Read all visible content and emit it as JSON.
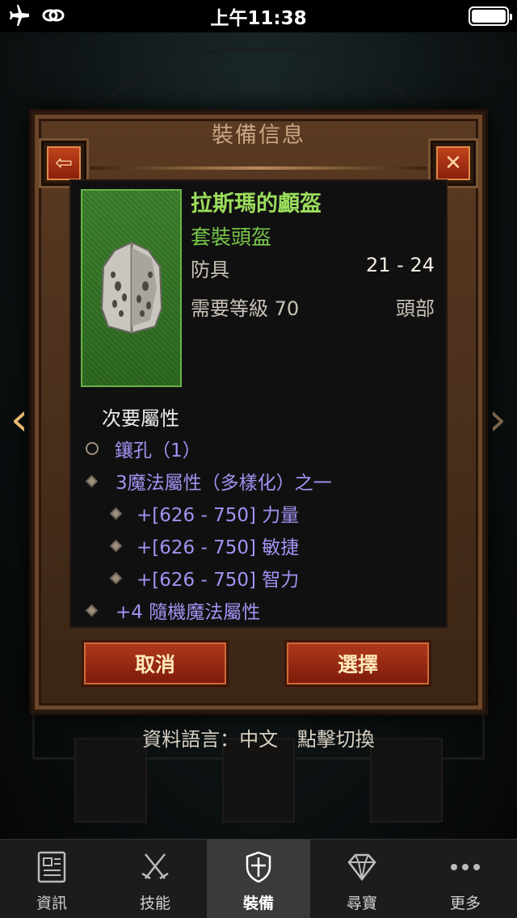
{
  "status_bar": {
    "time": "上午11:38",
    "battery_level": 1.0
  },
  "header": {
    "title": "裝備信息"
  },
  "item": {
    "name": "拉斯瑪的顱盔",
    "type": "套裝頭盔",
    "armor_label": "防具",
    "armor_value": "21 - 24",
    "level_req": "需要等級 70",
    "slot": "頭部"
  },
  "secondary": {
    "title": "次要屬性",
    "props": [
      {
        "text": "鑲孔（1）",
        "bullet": "ring"
      },
      {
        "text": "3魔法屬性（多樣化）之一",
        "bullet": "diamond"
      },
      {
        "text": "+[626 - 750] 力量",
        "bullet": "diamond"
      },
      {
        "text": "+[626 - 750] 敏捷",
        "bullet": "diamond"
      },
      {
        "text": "+[626 - 750] 智力",
        "bullet": "diamond"
      },
      {
        "text": "+4 隨機魔法屬性",
        "bullet": "diamond"
      }
    ]
  },
  "buttons": {
    "cancel": "取消",
    "select": "選擇"
  },
  "language": {
    "label": "資料語言：中文",
    "switch": "點擊切換"
  },
  "tabs": [
    {
      "label": "資訊",
      "icon": "news-icon"
    },
    {
      "label": "技能",
      "icon": "swords-icon"
    },
    {
      "label": "裝備",
      "icon": "shield-icon",
      "active": true
    },
    {
      "label": "尋寶",
      "icon": "gem-icon"
    },
    {
      "label": "更多",
      "icon": "more-icon"
    }
  ],
  "colors": {
    "item_name": "#9adc5c",
    "property": "#9f94f2",
    "button": "#b03a1c"
  }
}
